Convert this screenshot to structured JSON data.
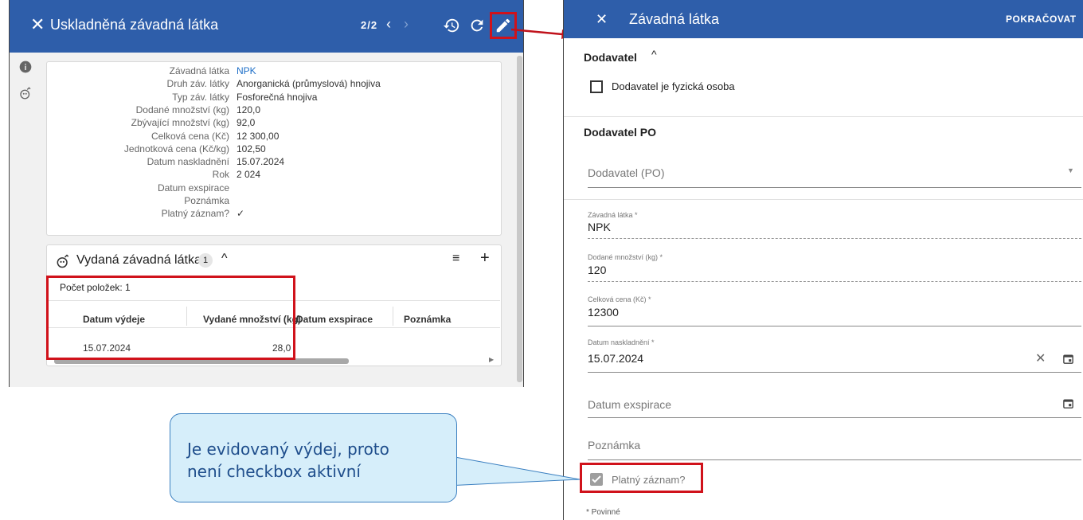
{
  "left": {
    "title": "Uskladněná závadná látka",
    "pager": "2/2",
    "details": [
      {
        "label": "Závadná látka",
        "value": "NPK",
        "link": true
      },
      {
        "label": "Druh záv. látky",
        "value": "Anorganická (průmyslová) hnojiva"
      },
      {
        "label": "Typ záv. látky",
        "value": "Fosforečná hnojiva"
      },
      {
        "label": "Dodané množství (kg)",
        "value": "120,0"
      },
      {
        "label": "Zbývající množství (kg)",
        "value": "92,0"
      },
      {
        "label": "Celková cena (Kč)",
        "value": "12 300,00"
      },
      {
        "label": "Jednotková cena (Kč/kg)",
        "value": "102,50"
      },
      {
        "label": "Datum naskladnění",
        "value": "15.07.2024"
      },
      {
        "label": "Rok",
        "value": "2 024"
      },
      {
        "label": "Datum exspirace",
        "value": ""
      },
      {
        "label": "Poznámka",
        "value": ""
      },
      {
        "label": "Platný záznam?",
        "value": "✓"
      }
    ],
    "issued": {
      "title": "Vydaná závadná látka",
      "count_badge": "1",
      "items_count": "Počet položek: 1",
      "columns": [
        "Datum výdeje",
        "Vydané množství (kg)",
        "Datum exspirace",
        "Poznámka"
      ],
      "rows": [
        [
          "15.07.2024",
          "28,0",
          "",
          ""
        ]
      ]
    }
  },
  "right": {
    "title": "Závadná látka",
    "continue_label": "POKRAČOVAT",
    "section_supplier": "Dodavatel",
    "checkbox_physical": "Dodavatel je fyzická osoba",
    "section_po": "Dodavatel PO",
    "supplier_po_placeholder": "Dodavatel (PO)",
    "fields": {
      "substance_label": "Závadná látka *",
      "substance_value": "NPK",
      "delivered_label": "Dodané množství (kg) *",
      "delivered_value": "120",
      "price_label": "Celková cena (Kč) *",
      "price_value": "12300",
      "stock_date_label": "Datum naskladnění *",
      "stock_date_value": "15.07.2024",
      "expiry_placeholder": "Datum exspirace",
      "note_placeholder": "Poznámka",
      "valid_label": "Platný záznam?"
    },
    "required_note": "* Povinné"
  },
  "callout": {
    "line1": "Je evidovaný výdej, proto",
    "line2": "není checkbox aktivní"
  },
  "colors": {
    "header": "#2e5eaa",
    "highlight": "#d0121b",
    "callout_bg": "#d6eefa",
    "link": "#1e6fc8"
  }
}
